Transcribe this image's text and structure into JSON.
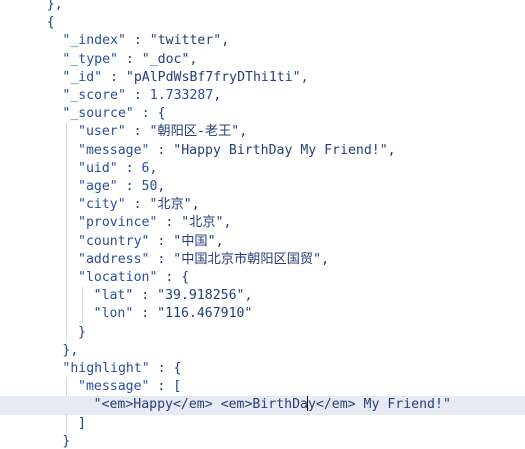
{
  "code": {
    "lines": [
      {
        "indent": 3,
        "tokens": [
          {
            "t": "},",
            "c": "punc"
          }
        ]
      },
      {
        "indent": 3,
        "tokens": [
          {
            "t": "{",
            "c": "punc"
          }
        ]
      },
      {
        "indent": 4,
        "tokens": [
          {
            "t": "\"_index\"",
            "c": "key"
          },
          {
            "t": " : ",
            "c": "punc"
          },
          {
            "t": "\"twitter\"",
            "c": "str"
          },
          {
            "t": ",",
            "c": "punc"
          }
        ]
      },
      {
        "indent": 4,
        "tokens": [
          {
            "t": "\"_type\"",
            "c": "key"
          },
          {
            "t": " : ",
            "c": "punc"
          },
          {
            "t": "\"_doc\"",
            "c": "str"
          },
          {
            "t": ",",
            "c": "punc"
          }
        ]
      },
      {
        "indent": 4,
        "tokens": [
          {
            "t": "\"_id\"",
            "c": "key"
          },
          {
            "t": " : ",
            "c": "punc"
          },
          {
            "t": "\"pAlPdWsBf7fryDThi1ti\"",
            "c": "str"
          },
          {
            "t": ",",
            "c": "punc"
          }
        ]
      },
      {
        "indent": 4,
        "tokens": [
          {
            "t": "\"_score\"",
            "c": "key"
          },
          {
            "t": " : ",
            "c": "punc"
          },
          {
            "t": "1.733287",
            "c": "num"
          },
          {
            "t": ",",
            "c": "punc"
          }
        ]
      },
      {
        "indent": 4,
        "tokens": [
          {
            "t": "\"_source\"",
            "c": "key"
          },
          {
            "t": " : {",
            "c": "punc"
          }
        ]
      },
      {
        "indent": 5,
        "tokens": [
          {
            "t": "\"user\"",
            "c": "key"
          },
          {
            "t": " : ",
            "c": "punc"
          },
          {
            "t": "\"朝阳区-老王\"",
            "c": "str"
          },
          {
            "t": ",",
            "c": "punc"
          }
        ]
      },
      {
        "indent": 5,
        "tokens": [
          {
            "t": "\"message\"",
            "c": "key"
          },
          {
            "t": " : ",
            "c": "punc"
          },
          {
            "t": "\"Happy BirthDay My Friend!\"",
            "c": "str"
          },
          {
            "t": ",",
            "c": "punc"
          }
        ]
      },
      {
        "indent": 5,
        "tokens": [
          {
            "t": "\"uid\"",
            "c": "key"
          },
          {
            "t": " : ",
            "c": "punc"
          },
          {
            "t": "6",
            "c": "num"
          },
          {
            "t": ",",
            "c": "punc"
          }
        ]
      },
      {
        "indent": 5,
        "tokens": [
          {
            "t": "\"age\"",
            "c": "key"
          },
          {
            "t": " : ",
            "c": "punc"
          },
          {
            "t": "50",
            "c": "num"
          },
          {
            "t": ",",
            "c": "punc"
          }
        ]
      },
      {
        "indent": 5,
        "tokens": [
          {
            "t": "\"city\"",
            "c": "key"
          },
          {
            "t": " : ",
            "c": "punc"
          },
          {
            "t": "\"北京\"",
            "c": "str"
          },
          {
            "t": ",",
            "c": "punc"
          }
        ]
      },
      {
        "indent": 5,
        "tokens": [
          {
            "t": "\"province\"",
            "c": "key"
          },
          {
            "t": " : ",
            "c": "punc"
          },
          {
            "t": "\"北京\"",
            "c": "str"
          },
          {
            "t": ",",
            "c": "punc"
          }
        ]
      },
      {
        "indent": 5,
        "tokens": [
          {
            "t": "\"country\"",
            "c": "key"
          },
          {
            "t": " : ",
            "c": "punc"
          },
          {
            "t": "\"中国\"",
            "c": "str"
          },
          {
            "t": ",",
            "c": "punc"
          }
        ]
      },
      {
        "indent": 5,
        "tokens": [
          {
            "t": "\"address\"",
            "c": "key"
          },
          {
            "t": " : ",
            "c": "punc"
          },
          {
            "t": "\"中国北京市朝阳区国贸\"",
            "c": "str"
          },
          {
            "t": ",",
            "c": "punc"
          }
        ]
      },
      {
        "indent": 5,
        "tokens": [
          {
            "t": "\"location\"",
            "c": "key"
          },
          {
            "t": " : {",
            "c": "punc"
          }
        ]
      },
      {
        "indent": 6,
        "tokens": [
          {
            "t": "\"lat\"",
            "c": "key"
          },
          {
            "t": " : ",
            "c": "punc"
          },
          {
            "t": "\"39.918256\"",
            "c": "str"
          },
          {
            "t": ",",
            "c": "punc"
          }
        ]
      },
      {
        "indent": 6,
        "tokens": [
          {
            "t": "\"lon\"",
            "c": "key"
          },
          {
            "t": " : ",
            "c": "punc"
          },
          {
            "t": "\"116.467910\"",
            "c": "str"
          }
        ]
      },
      {
        "indent": 5,
        "tokens": [
          {
            "t": "}",
            "c": "punc"
          }
        ]
      },
      {
        "indent": 4,
        "tokens": [
          {
            "t": "},",
            "c": "punc"
          }
        ]
      },
      {
        "indent": 4,
        "tokens": [
          {
            "t": "\"highlight\"",
            "c": "key"
          },
          {
            "t": " : {",
            "c": "punc"
          }
        ]
      },
      {
        "indent": 5,
        "tokens": [
          {
            "t": "\"message\"",
            "c": "key"
          },
          {
            "t": " : [",
            "c": "punc"
          }
        ]
      },
      {
        "indent": 6,
        "active": true,
        "tokens": [
          {
            "t": "\"<em>Happy</em> <em>BirthDa",
            "c": "str"
          },
          {
            "t": "",
            "c": "cursor"
          },
          {
            "t": "y</em> My Friend!\"",
            "c": "str"
          }
        ]
      },
      {
        "indent": 5,
        "tokens": [
          {
            "t": "]",
            "c": "punc"
          }
        ]
      },
      {
        "indent": 4,
        "tokens": [
          {
            "t": "}",
            "c": "punc"
          }
        ]
      }
    ]
  }
}
